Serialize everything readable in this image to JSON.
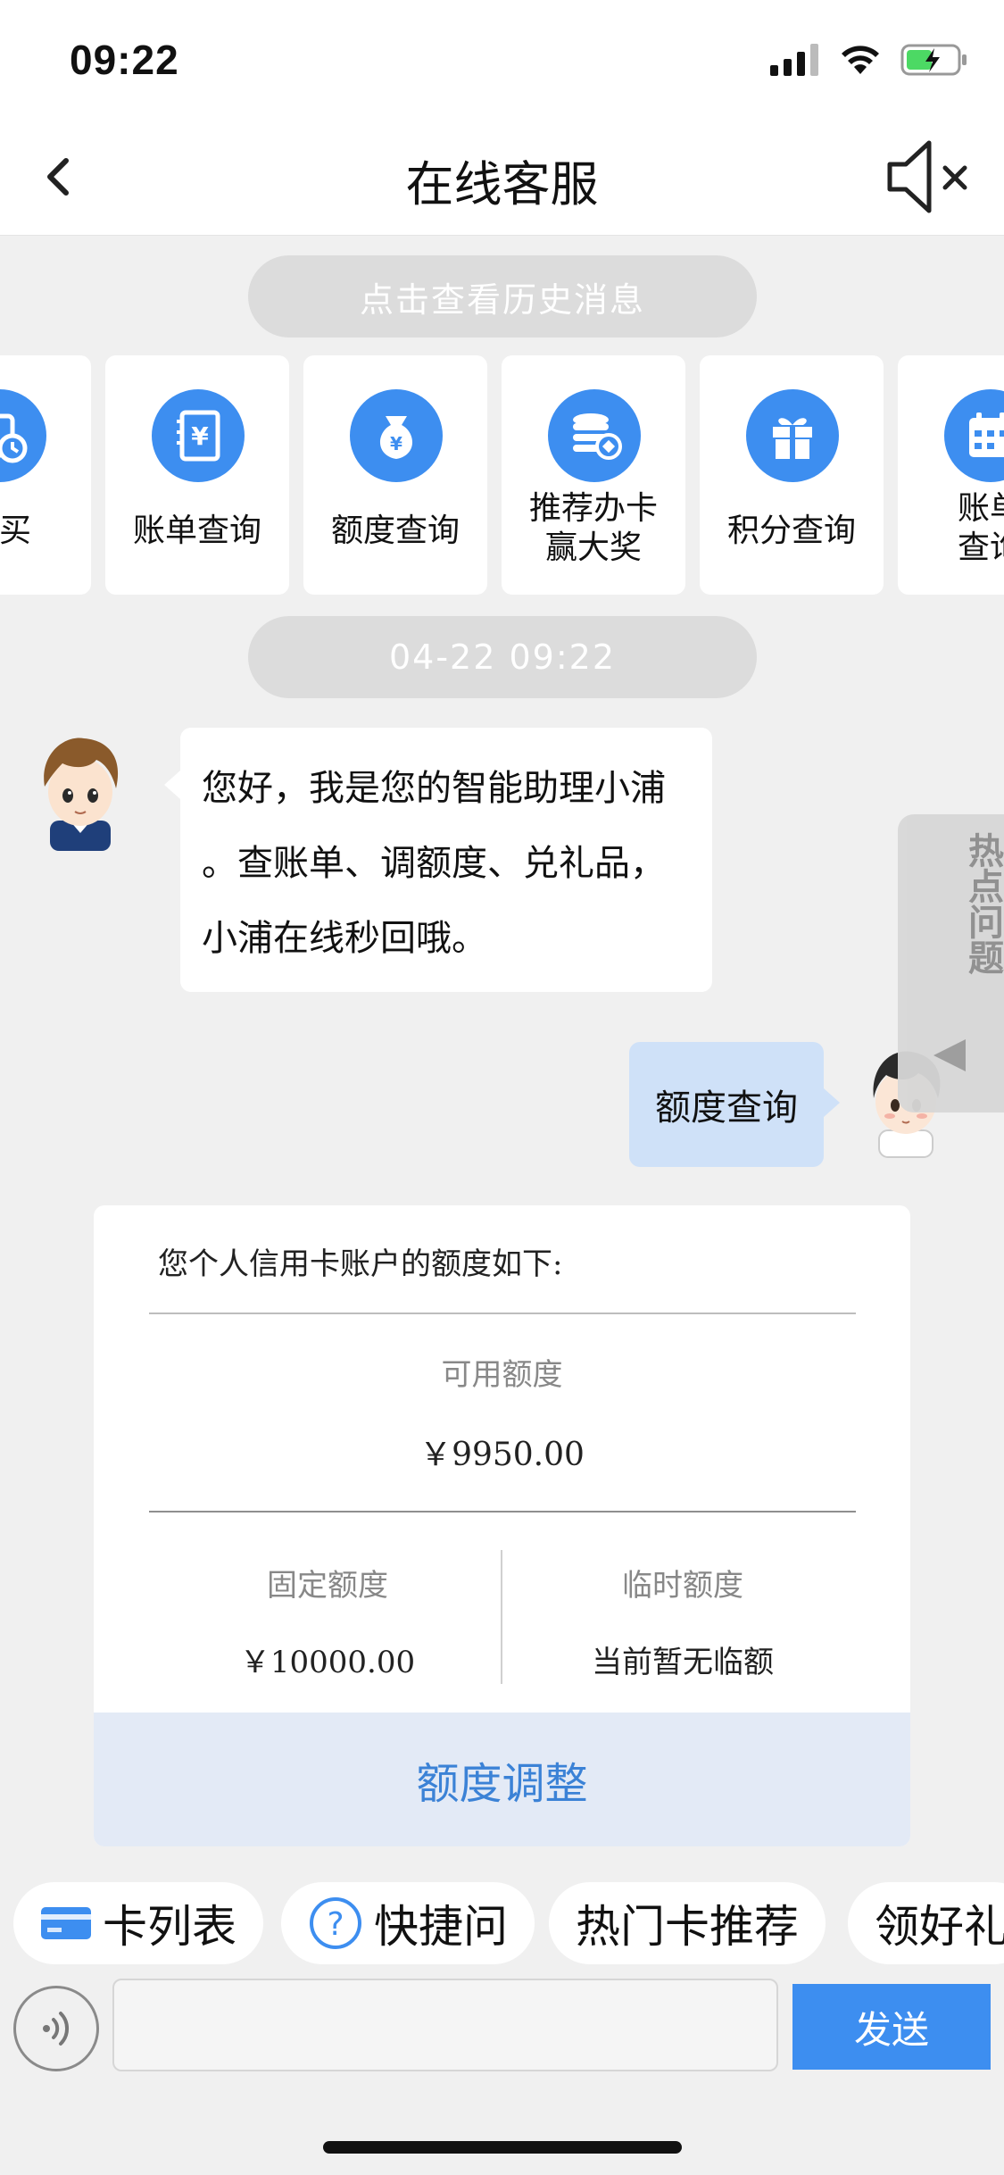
{
  "status_bar": {
    "time": "09:22"
  },
  "nav": {
    "title": "在线客服"
  },
  "history_pill": "点击查看历史消息",
  "quick_actions": [
    {
      "label": "心买",
      "icon": "clock-card-icon"
    },
    {
      "label": "账单查询",
      "icon": "bill-yen-icon"
    },
    {
      "label": "额度查询",
      "icon": "money-bag-icon"
    },
    {
      "label_line1": "推荐办卡",
      "label_line2": "赢大奖",
      "icon": "coins-stack-icon"
    },
    {
      "label": "积分查询",
      "icon": "gift-icon"
    },
    {
      "label_line1": "账单",
      "label_line2": "查询",
      "icon": "calendar-icon"
    }
  ],
  "timestamp_pill": "04-22 09:22",
  "bot_message": {
    "line1": "您好，我是您的智能助理小浦",
    "line2": "。查账单、调额度、兑礼品，",
    "line3": "小浦在线秒回哦。"
  },
  "user_message": "额度查询",
  "hot_tab": {
    "label": "热点问题"
  },
  "credit_card": {
    "heading": "您个人信用卡账户的额度如下:",
    "available_label": "可用额度",
    "available_value": "￥9950.00",
    "fixed_label": "固定额度",
    "fixed_value": "￥10000.00",
    "temp_label": "临时额度",
    "temp_value": "当前暂无临额",
    "adjust_button": "额度调整"
  },
  "chips": [
    {
      "label": "卡列表",
      "icon": "card-icon"
    },
    {
      "label": "快捷问",
      "icon": "question-icon"
    },
    {
      "label": "热门卡推荐",
      "icon": ""
    },
    {
      "label": "领好礼",
      "icon": ""
    }
  ],
  "input": {
    "value": "",
    "placeholder": ""
  },
  "send_button": "发送",
  "colors": {
    "accent": "#3d8ef0",
    "user_bubble": "#cfe1f8",
    "adjust_button_bg": "#e3eaf6",
    "adjust_text": "#3b82d6"
  }
}
